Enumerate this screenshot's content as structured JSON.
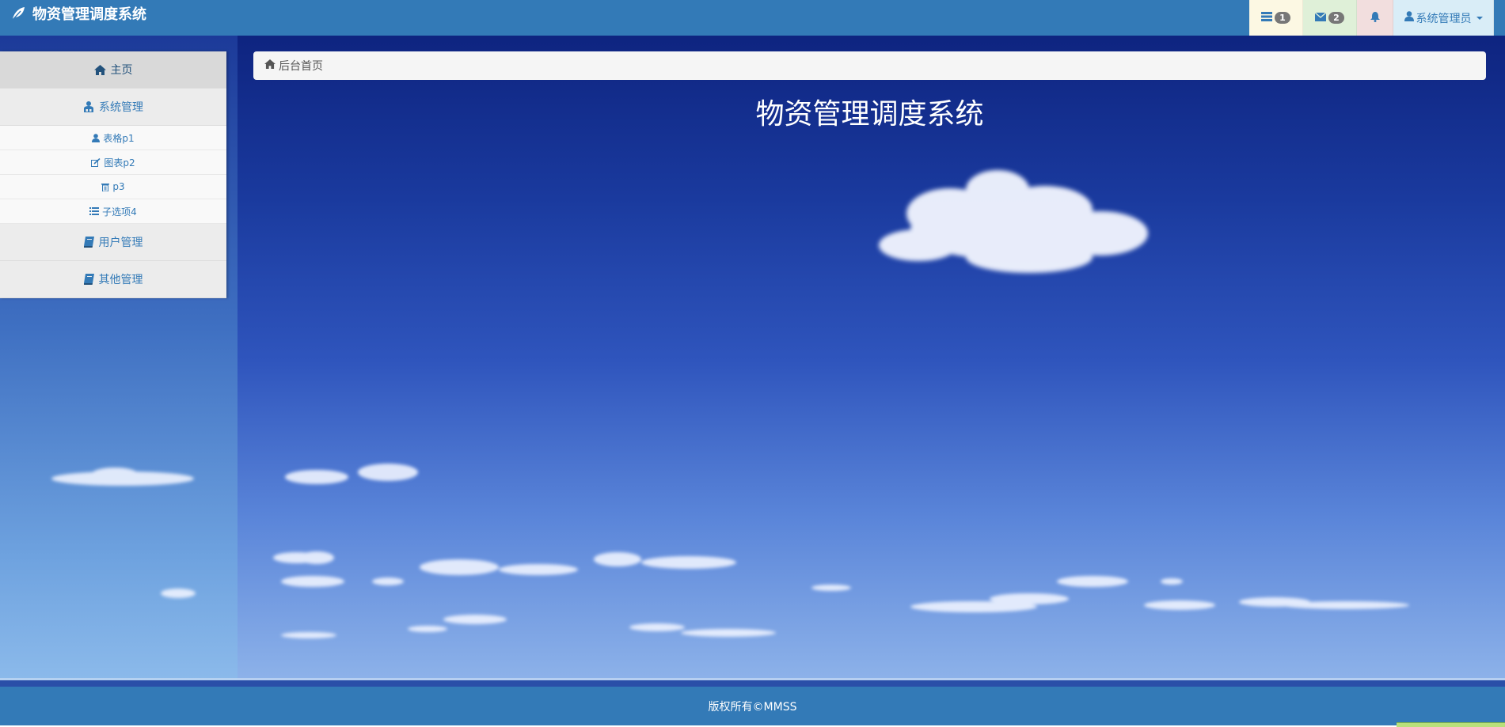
{
  "header": {
    "brand_title": "物资管理调度系统",
    "tasks_badge": "1",
    "messages_badge": "2",
    "user_label": "系统管理员"
  },
  "sidebar": {
    "items": [
      {
        "label": "主页",
        "icon": "home-icon"
      },
      {
        "label": "系统管理",
        "icon": "sitemap-icon"
      },
      {
        "label": "用户管理",
        "icon": "book-icon"
      },
      {
        "label": "其他管理",
        "icon": "book-icon"
      }
    ],
    "subitems": [
      {
        "label": "表格p1",
        "icon": "user-icon"
      },
      {
        "label": "图表p2",
        "icon": "edit-icon"
      },
      {
        "label": "p3",
        "icon": "trash-icon"
      },
      {
        "label": "子选项4",
        "icon": "list-icon"
      }
    ]
  },
  "breadcrumb": {
    "label": "后台首页",
    "icon": "home-icon"
  },
  "main": {
    "title": "物资管理调度系统"
  },
  "footer": {
    "text": "版权所有©MMSS"
  },
  "colors": {
    "primary": "#337ab7",
    "tasks_bg": "#fcf8e3",
    "messages_bg": "#dff0d8",
    "alerts_bg": "#f2dede",
    "user_bg": "#d9edf7",
    "sky_top": "#0e2480",
    "sky_bottom": "#8fb4ea"
  }
}
